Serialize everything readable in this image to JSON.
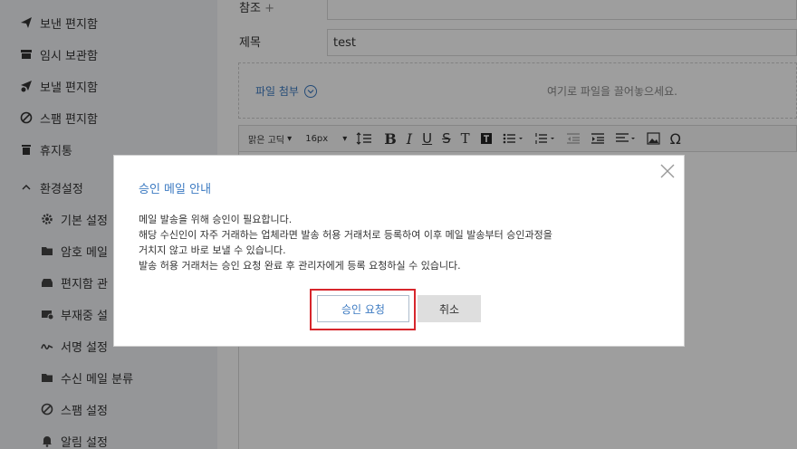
{
  "sidebar": {
    "items": [
      {
        "label": "보낸 편지함",
        "icon": "paper-plane-icon"
      },
      {
        "label": "임시 보관함",
        "icon": "inbox-tray-icon"
      },
      {
        "label": "보낼 편지함",
        "icon": "scheduled-send-icon"
      },
      {
        "label": "스팸 편지함",
        "icon": "block-icon"
      },
      {
        "label": "휴지통",
        "icon": "trash-icon"
      }
    ],
    "settings_header": "환경설정",
    "settings_items": [
      {
        "label": "기본 설정",
        "icon": "gear-icon"
      },
      {
        "label": "암호 메일",
        "icon": "folder-lock-icon"
      },
      {
        "label": "편지함 관",
        "icon": "mailbox-icon"
      },
      {
        "label": "부재중 설",
        "icon": "away-mail-icon"
      },
      {
        "label": "서명 설정",
        "icon": "signature-icon"
      },
      {
        "label": "수신 메일 분류",
        "icon": "folder-icon"
      },
      {
        "label": "스팸 설정",
        "icon": "block-icon"
      },
      {
        "label": "알림 설정",
        "icon": "bell-icon"
      }
    ]
  },
  "compose": {
    "cc_label": "참조",
    "cc_plus": "+",
    "subject_label": "제목",
    "subject_value": "test",
    "attach_label": "파일 첨부",
    "drop_hint": "여기로 파일을 끌어놓으세요.",
    "toolbar": {
      "font": "맑은 고딕",
      "size": "16px"
    }
  },
  "dialog": {
    "title": "승인 메일 안내",
    "line1": "메일 발송을 위해 승인이 필요합니다.",
    "line2": "해당 수신인이 자주 거래하는 업체라면 발송 허용 거래처로 등록하여 이후 메일 발송부터 승인과정을",
    "line3": "거치지 않고 바로 보낼 수 있습니다.",
    "line4": "발송 허용 거래처는 승인 요청 완료 후 관리자에게 등록 요청하실 수 있습니다.",
    "approve_label": "승인 요청",
    "cancel_label": "취소"
  },
  "colors": {
    "accent": "#3d7bc2",
    "highlight": "#d7262c",
    "sidebar_bg": "#f1f2f6"
  }
}
